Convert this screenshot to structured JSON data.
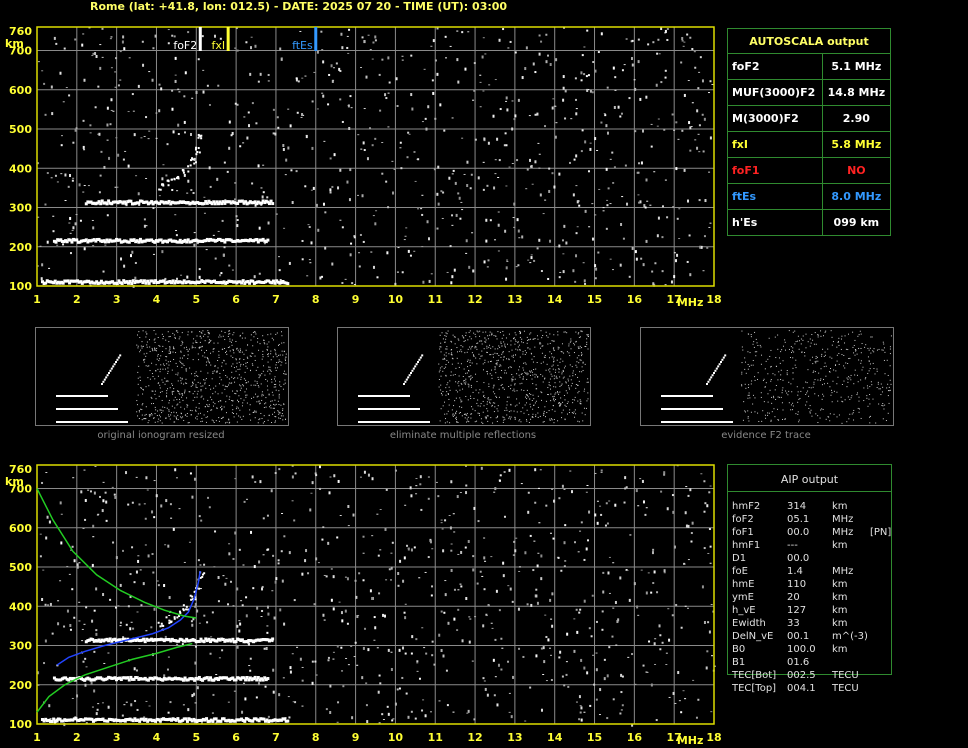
{
  "header": "Rome (lat: +41.8, lon: 012.5) - DATE: 2025 07 20 - TIME (UT): 03:00",
  "colors": {
    "grid": "#8a8a8a",
    "frame": "#dede00",
    "green": "#22cc22",
    "blue": "#2244ff",
    "yellow": "#ffff33",
    "red": "#ff2222",
    "es_blue": "#3399ff"
  },
  "top_markers": [
    {
      "label": "foF2",
      "freq": 5.1,
      "color": "#ffffff"
    },
    {
      "label": "fxI",
      "freq": 5.8,
      "color": "#ffff33"
    },
    {
      "label": "ftEs",
      "freq": 8.0,
      "color": "#3399ff"
    }
  ],
  "autoscala": {
    "title": "AUTOSCALA output",
    "rows": [
      {
        "name": "foF2",
        "value": "5.1 MHz",
        "color": "#ffffff"
      },
      {
        "name": "MUF(3000)F2",
        "value": "14.8 MHz",
        "color": "#ffffff"
      },
      {
        "name": "M(3000)F2",
        "value": "2.90",
        "color": "#ffffff"
      },
      {
        "name": "fxI",
        "value": "5.8 MHz",
        "color": "#ffff33"
      },
      {
        "name": "foF1",
        "value": "NO",
        "color": "#ff2222"
      },
      {
        "name": "ftEs",
        "value": "8.0 MHz",
        "color": "#3399ff"
      },
      {
        "name": "h'Es",
        "value": "099    km",
        "color": "#ffffff"
      }
    ]
  },
  "thumbnails": [
    "original ionogram resized",
    "eliminate multiple reflections",
    "evidence F2 trace"
  ],
  "aip": {
    "title": "AIP output",
    "rows": [
      {
        "name": "hmF2",
        "value": "314",
        "unit": "km",
        "extra": ""
      },
      {
        "name": "foF2",
        "value": "05.1",
        "unit": "MHz",
        "extra": ""
      },
      {
        "name": "foF1",
        "value": "00.0",
        "unit": "MHz",
        "extra": "[PN]"
      },
      {
        "name": "hmF1",
        "value": "---",
        "unit": "km",
        "extra": ""
      },
      {
        "name": "D1",
        "value": "00.0",
        "unit": "",
        "extra": ""
      },
      {
        "name": "foE",
        "value": "1.4",
        "unit": "MHz",
        "extra": ""
      },
      {
        "name": "hmE",
        "value": "110",
        "unit": "km",
        "extra": ""
      },
      {
        "name": "ymE",
        "value": "20",
        "unit": "km",
        "extra": ""
      },
      {
        "name": "h_vE",
        "value": "127",
        "unit": "km",
        "extra": ""
      },
      {
        "name": "Ewidth",
        "value": "33",
        "unit": "km",
        "extra": ""
      },
      {
        "name": "DelN_vE",
        "value": "00.1",
        "unit": "m^(-3)",
        "extra": ""
      },
      {
        "name": "B0",
        "value": "100.0",
        "unit": "km",
        "extra": ""
      },
      {
        "name": "B1",
        "value": "01.6",
        "unit": "",
        "extra": ""
      },
      {
        "name": "TEC[Bot]",
        "value": "002.5",
        "unit": "TECU",
        "extra": ""
      },
      {
        "name": "TEC[Top]",
        "value": "004.1",
        "unit": "TECU",
        "extra": ""
      }
    ]
  },
  "chart_data": [
    {
      "type": "scatter",
      "name": "ionogram-autoscala",
      "xlim": [
        1,
        18
      ],
      "ylim": [
        100,
        760
      ],
      "xticks": [
        1,
        2,
        3,
        4,
        5,
        6,
        7,
        8,
        9,
        10,
        11,
        12,
        13,
        14,
        15,
        16,
        17,
        18
      ],
      "yticks": [
        100,
        200,
        300,
        400,
        500,
        600,
        700,
        760
      ],
      "ylabel": "km",
      "xlabel": "MHz",
      "traces": [
        {
          "name": "E-layer",
          "x0": 1.1,
          "x1": 7.3,
          "h": 110
        },
        {
          "name": "2E",
          "x0": 1.4,
          "x1": 6.8,
          "h": 215
        },
        {
          "name": "F2-low",
          "x0": 2.2,
          "x1": 6.9,
          "h": 313
        }
      ],
      "f2_trace": [
        [
          4.1,
          352
        ],
        [
          4.3,
          368
        ],
        [
          4.5,
          380
        ],
        [
          4.7,
          398
        ],
        [
          4.9,
          420
        ],
        [
          5.0,
          445
        ],
        [
          5.1,
          480
        ]
      ]
    },
    {
      "type": "line",
      "name": "ionogram-aip",
      "xlim": [
        1,
        18
      ],
      "ylim": [
        100,
        760
      ],
      "series": [
        {
          "name": "blue",
          "color": "#2244ff",
          "x": [
            1.5,
            1.8,
            2.2,
            2.7,
            3.3,
            3.9,
            4.3,
            4.6,
            4.8,
            4.95,
            5.05,
            5.1
          ],
          "y": [
            250,
            270,
            285,
            300,
            315,
            330,
            345,
            365,
            385,
            420,
            460,
            490
          ]
        },
        {
          "name": "green-upper",
          "color": "#22cc22",
          "x": [
            1.0,
            1.4,
            1.9,
            2.5,
            3.1,
            3.7,
            4.2,
            4.7,
            5.0
          ],
          "y": [
            700,
            620,
            540,
            480,
            440,
            410,
            390,
            375,
            370
          ]
        },
        {
          "name": "green-lower",
          "color": "#22cc22",
          "x": [
            1.0,
            1.3,
            1.7,
            2.2,
            2.8,
            3.4,
            4.0,
            4.5,
            4.9
          ],
          "y": [
            130,
            170,
            200,
            225,
            245,
            265,
            280,
            295,
            305
          ]
        }
      ]
    }
  ]
}
